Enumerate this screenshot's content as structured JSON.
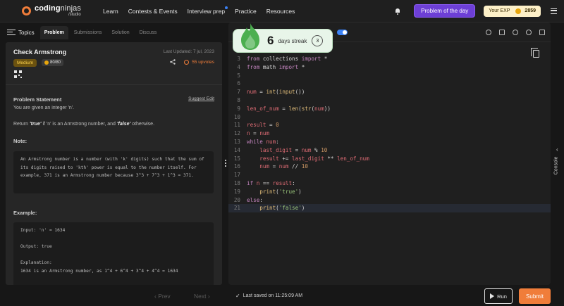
{
  "brand": {
    "name_bold": "coding",
    "name_light": "ninjas",
    "sub": "/studio"
  },
  "nav": {
    "links": [
      "Learn",
      "Contests & Events",
      "Interview prep",
      "Practice",
      "Resources"
    ],
    "potd_label": "Problem of the day",
    "exp_label": "Your EXP",
    "exp_value": "2859"
  },
  "left": {
    "topics_label": "Topics",
    "tabs": [
      "Problem",
      "Submissions",
      "Solution",
      "Discuss"
    ],
    "title": "Check Armstrong",
    "updated": "Last Updated: 7 jul, 2023",
    "difficulty": "Medium",
    "score": "80/80",
    "upvotes": "55 upvotes",
    "statement_heading": "Problem Statement",
    "suggest_edit": "Suggest Edit",
    "line1": "You are given an integer 'n'.",
    "line2_pre": "Return ",
    "line2_true": "'true'",
    "line2_mid": " if 'n' is an Armstrong number, and ",
    "line2_false": "'false'",
    "line2_post": " otherwise.",
    "note_heading": "Note:",
    "note_text": "An Armstrong number is a number (with 'k' digits) such that the sum of its digits raised to 'kth' power is equal to the number itself. For example, 371 is an Armstrong number because 3^3 + 7^3 + 1^3 = 371.",
    "example_heading": "Example:",
    "example_text": "Input: 'n' = 1634\n\nOutput: true\n\nExplanation:\n1634 is an Armstrong number, as 1^4 + 6^4 + 3^4 + 4^4 = 1634"
  },
  "streak": {
    "count": "6",
    "label": "days streak",
    "badge": "3"
  },
  "code_lines": [
    {
      "n": "3",
      "html": "<span class='kw'>from</span> <span class='op'>collections</span> <span class='kw'>import</span> <span class='op'>*</span>"
    },
    {
      "n": "4",
      "html": "<span class='kw'>from</span> <span class='op'>math</span> <span class='kw'>import</span> <span class='op'>*</span>"
    },
    {
      "n": "5",
      "html": ""
    },
    {
      "n": "6",
      "html": ""
    },
    {
      "n": "7",
      "html": "<span class='var'>num</span> <span class='op'>=</span> <span class='fn'>int</span><span class='op'>(</span><span class='fn'>input</span><span class='op'>())</span>"
    },
    {
      "n": "8",
      "html": ""
    },
    {
      "n": "9",
      "html": "<span class='var'>len_of_num</span> <span class='op'>=</span> <span class='fn'>len</span><span class='op'>(</span><span class='fn'>str</span><span class='op'>(</span><span class='var'>num</span><span class='op'>))</span>"
    },
    {
      "n": "10",
      "html": ""
    },
    {
      "n": "11",
      "html": "<span class='var'>result</span> <span class='op'>=</span> <span class='num'>0</span>"
    },
    {
      "n": "12",
      "html": "<span class='var'>n</span> <span class='op'>=</span> <span class='var'>num</span>"
    },
    {
      "n": "13",
      "html": "<span class='kw'>while</span> <span class='var'>num</span><span class='op'>:</span>"
    },
    {
      "n": "14",
      "html": "    <span class='var'>last_digit</span> <span class='op'>=</span> <span class='var'>num</span> <span class='op'>%</span> <span class='num'>10</span>"
    },
    {
      "n": "15",
      "html": "    <span class='var'>result</span> <span class='op'>+=</span> <span class='var'>last_digit</span> <span class='op'>**</span> <span class='var'>len_of_num</span>"
    },
    {
      "n": "16",
      "html": "    <span class='var'>num</span> <span class='op'>=</span> <span class='var'>num</span> <span class='op'>//</span> <span class='num'>10</span>"
    },
    {
      "n": "17",
      "html": ""
    },
    {
      "n": "18",
      "html": "<span class='kw'>if</span> <span class='var'>n</span> <span class='op'>==</span> <span class='var'>result</span><span class='op'>:</span>"
    },
    {
      "n": "19",
      "html": "    <span class='fn'>print</span><span class='op'>(</span><span class='str'>'true'</span><span class='op'>)</span>"
    },
    {
      "n": "20",
      "html": "<span class='kw'>else</span><span class='op'>:</span>"
    },
    {
      "n": "21",
      "html": "    <span class='fn'>print</span><span class='op'>(</span><span class='str'>'false'</span><span class='op'>)</span>"
    }
  ],
  "console_label": "Console",
  "bottom": {
    "prev": "‹ Prev",
    "next": "Next ›",
    "saved": "Last saved on 11:25:09 AM",
    "run": "Run",
    "submit": "Submit"
  },
  "colors": {
    "accent": "#f07d3a",
    "potd": "#6d3fd6",
    "streak_bg": "#e8f5e9"
  },
  "icons": [
    "bell-icon",
    "menu-icon",
    "topics-icon",
    "share-icon",
    "upvote-icon",
    "qr-icon",
    "copy-icon",
    "flame-icon",
    "timer-icon",
    "save-icon",
    "reset-icon",
    "settings-icon",
    "fullscreen-icon",
    "play-icon",
    "check-icon"
  ]
}
